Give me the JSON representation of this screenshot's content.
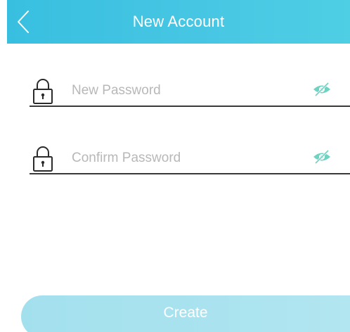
{
  "header": {
    "title": "New Account",
    "back_icon": "chevron-left-icon",
    "background_color": "#46c6e3"
  },
  "form": {
    "new_password": {
      "placeholder": "New Password",
      "value": "",
      "leading_icon": "lock-icon",
      "trailing_icon": "eye-slash-icon"
    },
    "confirm_password": {
      "placeholder": "Confirm Password",
      "value": "",
      "leading_icon": "lock-icon",
      "trailing_icon": "eye-slash-icon"
    }
  },
  "actions": {
    "create_label": "Create",
    "create_button_color": "#a8e2ef"
  },
  "colors": {
    "accent": "#46c6e3",
    "eye_icon": "#6fd3c4",
    "underline": "#3a3a3a",
    "placeholder": "#b8b8b8"
  }
}
